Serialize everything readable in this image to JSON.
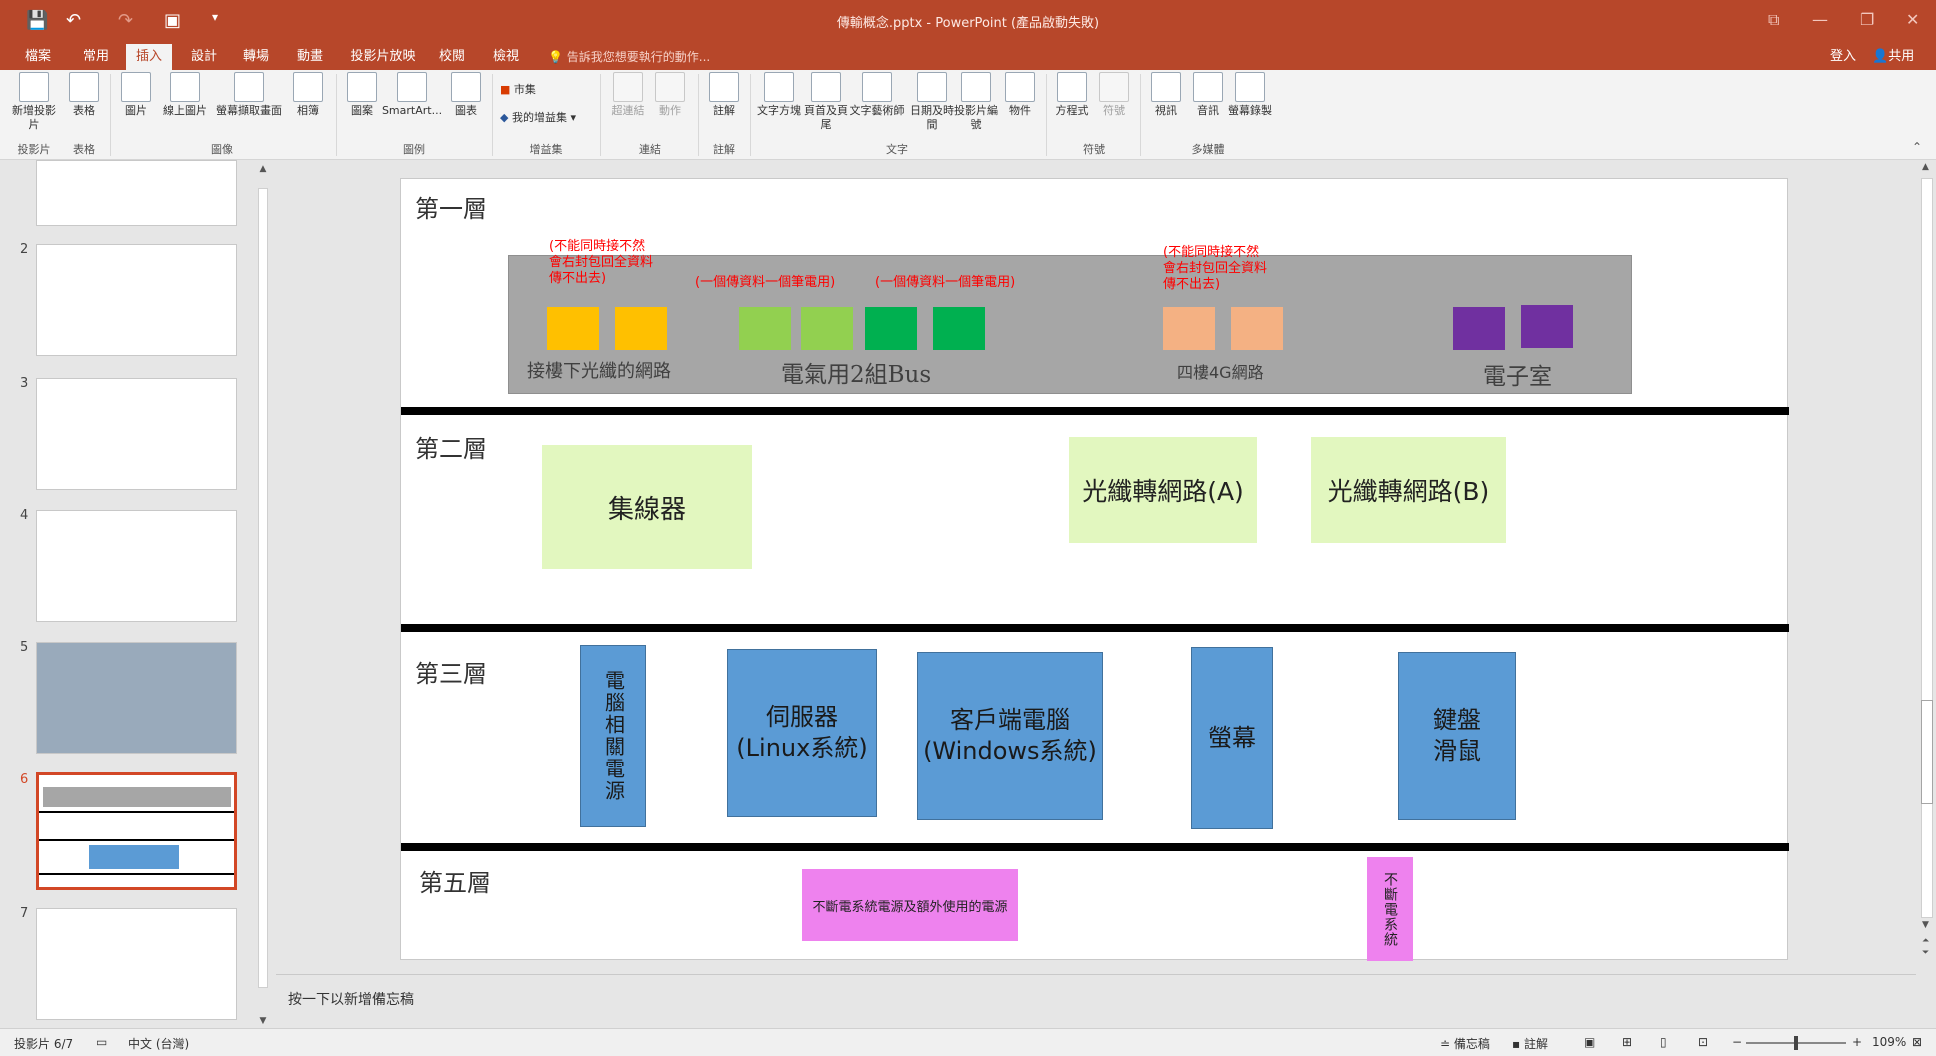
{
  "window": {
    "title": "傳輸概念.pptx - PowerPoint (產品啟動失敗)",
    "qat": {
      "save": "💾",
      "undo": "↶",
      "redo": "↷",
      "present": "▣",
      "more": "▾"
    },
    "controls": {
      "ribbon_opts": "⧉",
      "min": "—",
      "max": "❐",
      "close": "✕"
    }
  },
  "tabs": [
    "檔案",
    "常用",
    "插入",
    "設計",
    "轉場",
    "動畫",
    "投影片放映",
    "校閱",
    "檢視"
  ],
  "tell_me": "告訴我您想要執行的動作...",
  "account": {
    "signin": "登入",
    "share": "共用"
  },
  "ribbon": {
    "buttons": [
      "新增投影片",
      "表格",
      "圖片",
      "線上圖片",
      "螢幕擷取畫面",
      "相簿",
      "圖案",
      "SmartArt...",
      "圖表",
      "超連結",
      "動作",
      "註解",
      "文字方塊",
      "頁首及頁尾",
      "文字藝術師",
      "日期及時間",
      "投影片編號",
      "物件",
      "方程式",
      "符號",
      "視訊",
      "音訊",
      "螢幕錄製"
    ],
    "store": "市集",
    "my_addins": "我的增益集",
    "groups": [
      "投影片",
      "表格",
      "圖像",
      "圖例",
      "增益集",
      "連結",
      "註解",
      "文字",
      "符號",
      "多媒體"
    ]
  },
  "thumbnails": [
    "2",
    "3",
    "4",
    "5",
    "6",
    "7"
  ],
  "slide": {
    "layer1": "第一層",
    "layer2": "第二層",
    "layer3": "第三層",
    "layer5": "第五層",
    "red_note_a": "(不能同時接不然\n會右封包回全資料\n傳不出去)",
    "red_note_b": "(一個傳資料一個筆電用)",
    "red_note_c": "(一個傳資料一個筆電用)",
    "red_note_d": "(不能同時接不然\n會右封包回全資料\n傳不出去)",
    "gray_labels": [
      "接樓下光纖的網路",
      "電氣用2組Bus",
      "四樓4G網路",
      "電子室"
    ],
    "hub": "集線器",
    "fiber_a": "光纖轉網路(A)",
    "fiber_b": "光纖轉網路(B)",
    "pc_power": "電腦相關電源",
    "server": "伺服器\n(Linux系統)",
    "client": "客戶端電腦\n(Windows系統)",
    "monitor": "螢幕",
    "kbm": "鍵盤\n滑鼠",
    "ups_power": "不斷電系統電源及額外使用的電源",
    "ups": "不斷電系統",
    "colors": {
      "yellow": "#ffc000",
      "lightgreen": "#92d050",
      "green": "#00b050",
      "peach": "#f4b183",
      "purple": "#7030a0",
      "gray": "#a6a6a6",
      "lightbox": "#e2f7bf",
      "blue": "#5b9bd5",
      "pink": "#ee82ee"
    }
  },
  "notes_placeholder": "按一下以新增備忘稿",
  "status": {
    "slide_count": "投影片 6/7",
    "language": "中文 (台灣)",
    "notes": "備忘稿",
    "comments": "註解",
    "zoom": "109%"
  }
}
